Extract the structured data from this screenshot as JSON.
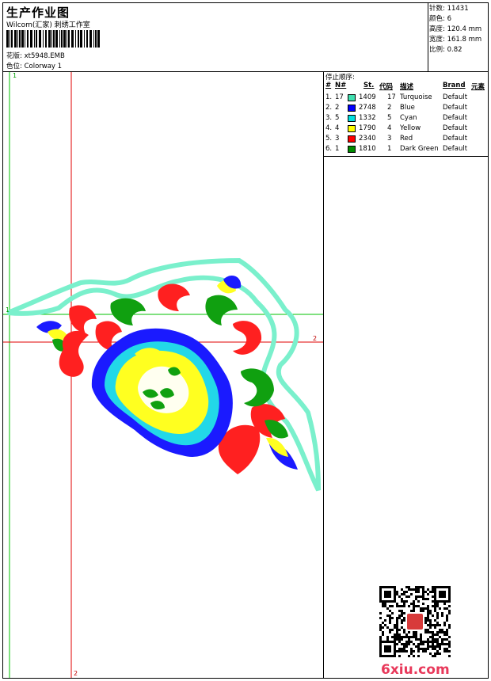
{
  "header": {
    "title": "生产作业图",
    "company": "Wilcom(汇家) 刺绣工作室",
    "pattern_label": "花版:",
    "pattern_value": "xt5948.EMB",
    "colorway_label": "色位:",
    "colorway_value": "Colorway 1"
  },
  "stats": [
    {
      "label": "针数:",
      "value": "11431"
    },
    {
      "label": "颜色:",
      "value": "6"
    },
    {
      "label": "高度:",
      "value": "120.4 mm"
    },
    {
      "label": "宽度:",
      "value": "161.8 mm"
    },
    {
      "label": "比例:",
      "value": "0.82"
    }
  ],
  "stop_sequence": {
    "title": "停止顺序:",
    "columns": [
      "#",
      "N#",
      "St.",
      "代码",
      "描述",
      "Brand",
      "元素"
    ],
    "rows": [
      {
        "idx": "1.",
        "n": "17",
        "color": "#40e0b0",
        "st": "1409",
        "code": "17",
        "desc": "Turquoise",
        "brand": "Default"
      },
      {
        "idx": "2.",
        "n": "2",
        "color": "#0000ff",
        "st": "2748",
        "code": "2",
        "desc": "Blue",
        "brand": "Default"
      },
      {
        "idx": "3.",
        "n": "5",
        "color": "#00e0e0",
        "st": "1332",
        "code": "5",
        "desc": "Cyan",
        "brand": "Default"
      },
      {
        "idx": "4.",
        "n": "4",
        "color": "#ffff00",
        "st": "1790",
        "code": "4",
        "desc": "Yellow",
        "brand": "Default"
      },
      {
        "idx": "5.",
        "n": "3",
        "color": "#ff0000",
        "st": "2340",
        "code": "3",
        "desc": "Red",
        "brand": "Default"
      },
      {
        "idx": "6.",
        "n": "1",
        "color": "#008c00",
        "st": "1810",
        "code": "1",
        "desc": "Dark Green",
        "brand": "Default"
      }
    ]
  },
  "axes": {
    "green_top": "1",
    "green_left": "1",
    "red_right": "2",
    "red_bottom": "2"
  },
  "watermark": "6xiu.com",
  "colors": {
    "turquoise": "#7af0cc",
    "blue": "#1a1aff",
    "cyan": "#22d8e8",
    "yellow": "#ffff20",
    "red": "#ff2020",
    "green": "#10a010"
  }
}
